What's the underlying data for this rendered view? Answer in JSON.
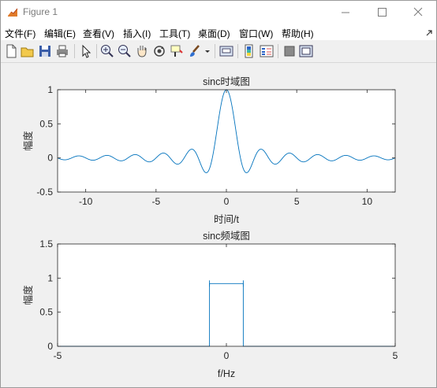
{
  "window": {
    "title": "Figure 1",
    "accent": "#0072bd"
  },
  "menu": [
    {
      "label": "文件(F)"
    },
    {
      "label": "编辑(E)"
    },
    {
      "label": "查看(V)"
    },
    {
      "label": "插入(I)"
    },
    {
      "label": "工具(T)"
    },
    {
      "label": "桌面(D)"
    },
    {
      "label": "窗口(W)"
    },
    {
      "label": "帮助(H)"
    }
  ],
  "toolbar": [
    {
      "icon": "new-figure-icon"
    },
    {
      "icon": "open-file-icon"
    },
    {
      "icon": "save-icon"
    },
    {
      "icon": "print-icon"
    },
    {
      "icon": "pointer-icon"
    },
    {
      "icon": "zoom-in-icon"
    },
    {
      "icon": "zoom-out-icon"
    },
    {
      "icon": "pan-hand-icon"
    },
    {
      "icon": "rotate-3d-icon"
    },
    {
      "icon": "data-cursor-icon"
    },
    {
      "icon": "brush-icon"
    },
    {
      "icon": "link-plot-icon"
    },
    {
      "icon": "colorbar-icon"
    },
    {
      "icon": "legend-icon"
    },
    {
      "icon": "hide-plot-tools-icon"
    },
    {
      "icon": "show-plot-tools-icon"
    }
  ],
  "chart_data": [
    {
      "type": "line",
      "title": "sinc时域图",
      "xlabel": "时间/t",
      "ylabel": "幅度",
      "xlim": [
        -12,
        12
      ],
      "ylim": [
        -0.5,
        1
      ],
      "xticks": [
        -10,
        -5,
        0,
        5,
        10
      ],
      "yticks": [
        -0.5,
        0,
        0.5,
        1
      ],
      "xtick_labels": [
        "-10",
        "-5",
        "0",
        "5",
        "10"
      ],
      "ytick_labels": [
        "-0.5",
        "0",
        "0.5",
        "1"
      ],
      "function": "sin(pi*t)/(pi*t)",
      "x_sample_range": [
        -12,
        12
      ],
      "color": "#0072bd",
      "grid": false,
      "box": true
    },
    {
      "type": "line",
      "title": "sinc频域图",
      "xlabel": "f/Hz",
      "ylabel": "幅度",
      "xlim": [
        -5,
        5
      ],
      "ylim": [
        0,
        1.5
      ],
      "xticks": [
        -5,
        0,
        5
      ],
      "yticks": [
        0,
        0.5,
        1,
        1.5
      ],
      "xtick_labels": [
        "-5",
        "0",
        "5"
      ],
      "ytick_labels": [
        "0",
        "0.5",
        "1",
        "1.5"
      ],
      "x": [
        -5,
        -0.5,
        -0.5,
        -0.5,
        0.5,
        0.5,
        0.5,
        5
      ],
      "y": [
        0,
        0,
        0.92,
        0.92,
        0.92,
        0.92,
        0,
        0
      ],
      "color": "#0072bd",
      "grid": false,
      "box": true
    }
  ]
}
